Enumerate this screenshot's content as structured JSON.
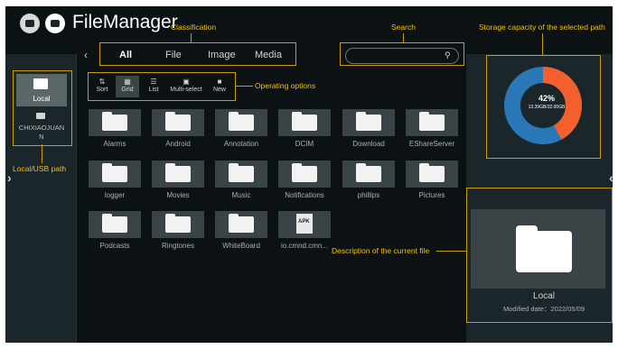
{
  "app": {
    "title": "FileManager"
  },
  "tabs": [
    "All",
    "File",
    "Image",
    "Media"
  ],
  "annotations": {
    "classification": "Classification",
    "search": "Search",
    "storage": "Storage capacity of the selected path",
    "operating": "Operating options",
    "local_usb": "Local/USB path",
    "description": "Description of the current file"
  },
  "operations": [
    {
      "label": "Sort",
      "icon": "sort-icon"
    },
    {
      "label": "Grid",
      "icon": "grid-icon"
    },
    {
      "label": "List",
      "icon": "list-icon"
    },
    {
      "label": "Multi-select",
      "icon": "multi-select-icon"
    },
    {
      "label": "New",
      "icon": "new-folder-icon"
    }
  ],
  "sidebar": {
    "local_label": "Local",
    "usb_label": "CHIXIAOJUAN",
    "usb_label_tail": "N"
  },
  "files": [
    {
      "name": "Alarms",
      "type": "folder"
    },
    {
      "name": "Android",
      "type": "folder"
    },
    {
      "name": "Annotation",
      "type": "folder"
    },
    {
      "name": "DCIM",
      "type": "folder"
    },
    {
      "name": "Download",
      "type": "folder"
    },
    {
      "name": "EShareServer",
      "type": "folder"
    },
    {
      "name": "logger",
      "type": "folder"
    },
    {
      "name": "Movies",
      "type": "folder"
    },
    {
      "name": "Music",
      "type": "folder"
    },
    {
      "name": "Notifications",
      "type": "folder"
    },
    {
      "name": "phillips",
      "type": "folder"
    },
    {
      "name": "Pictures",
      "type": "folder"
    },
    {
      "name": "Podcasts",
      "type": "folder"
    },
    {
      "name": "Ringtones",
      "type": "folder"
    },
    {
      "name": "WhiteBoard",
      "type": "folder"
    },
    {
      "name": "io.cmnd.cmn...",
      "type": "apk",
      "badge": "APK"
    }
  ],
  "storage": {
    "percent": "42%",
    "detail": "13.39GB/32.00GB",
    "used_fraction": 0.42
  },
  "preview": {
    "name": "Local",
    "date": "Modified date：2022/05/09"
  },
  "colors": {
    "donut_used": "#f45f2e",
    "donut_free": "#2a78b8",
    "annotation": "#f5c200"
  }
}
